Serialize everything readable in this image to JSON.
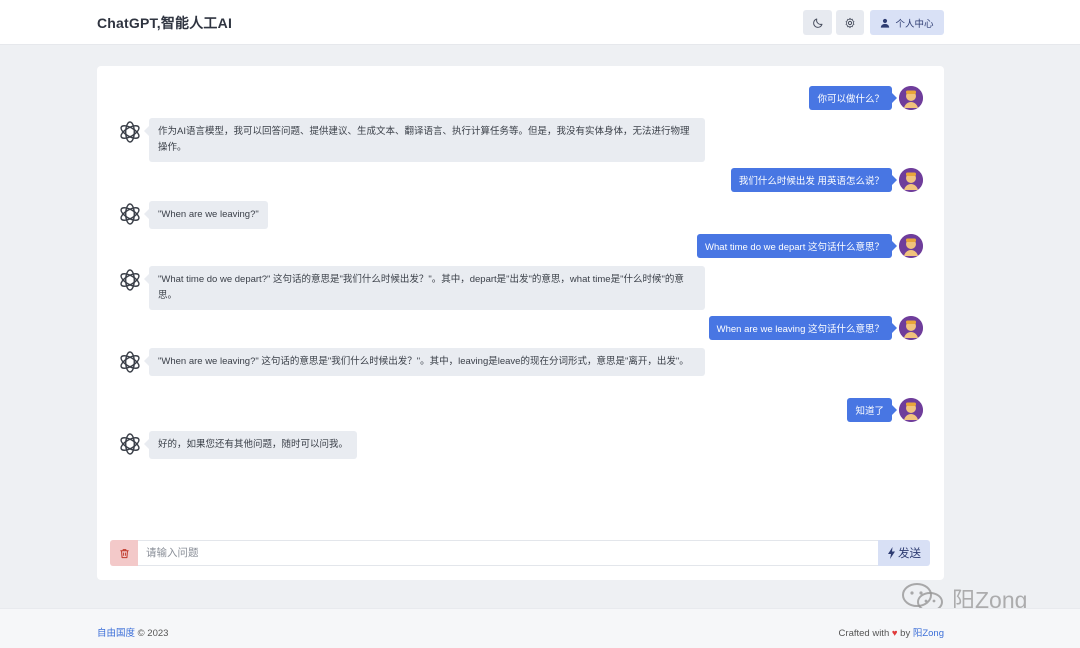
{
  "header": {
    "title": "ChatGPT,智能人工AI",
    "profile_label": "个人中心"
  },
  "chat": {
    "messages": [
      {
        "role": "user",
        "text": "你可以做什么？"
      },
      {
        "role": "assistant",
        "text": "作为AI语言模型，我可以回答问题、提供建议、生成文本、翻译语言、执行计算任务等。但是，我没有实体身体，无法进行物理操作。"
      },
      {
        "role": "user",
        "text": "我们什么时候出发 用英语怎么说？"
      },
      {
        "role": "assistant",
        "text": "\"When are we leaving?\""
      },
      {
        "role": "user",
        "text": "What time do we depart 这句话什么意思？"
      },
      {
        "role": "assistant",
        "text": "\"What time do we depart?\" 这句话的意思是\"我们什么时候出发？\"。其中，depart是\"出发\"的意思，what time是\"什么时候\"的意思。"
      },
      {
        "role": "user",
        "text": "When are we leaving 这句话什么意思？"
      },
      {
        "role": "assistant",
        "text": "\"When are we leaving?\" 这句话的意思是\"我们什么时候出发？\"。其中，leaving是leave的现在分词形式，意思是\"离开，出发\"。"
      },
      {
        "role": "user",
        "text": "知道了"
      },
      {
        "role": "assistant",
        "text": "好的，如果您还有其他问题，随时可以问我。"
      }
    ]
  },
  "composer": {
    "placeholder": "请输入问题",
    "send_label": "发送"
  },
  "footer": {
    "org": "自由国度",
    "copyright": "© 2023",
    "crafted": "Crafted with",
    "by": "by",
    "author": "阳Zong"
  },
  "watermark": {
    "text": "阳Zong"
  },
  "colors": {
    "accent": "#4876e3",
    "bot_bubble": "#e9ecf1",
    "delete": "#f3c9c9",
    "heart": "#e0393a"
  },
  "icons": [
    "moon-icon",
    "gear-icon",
    "user-icon",
    "trash-icon",
    "bolt-icon",
    "openai-icon",
    "wechat-icon",
    "heart-icon"
  ]
}
